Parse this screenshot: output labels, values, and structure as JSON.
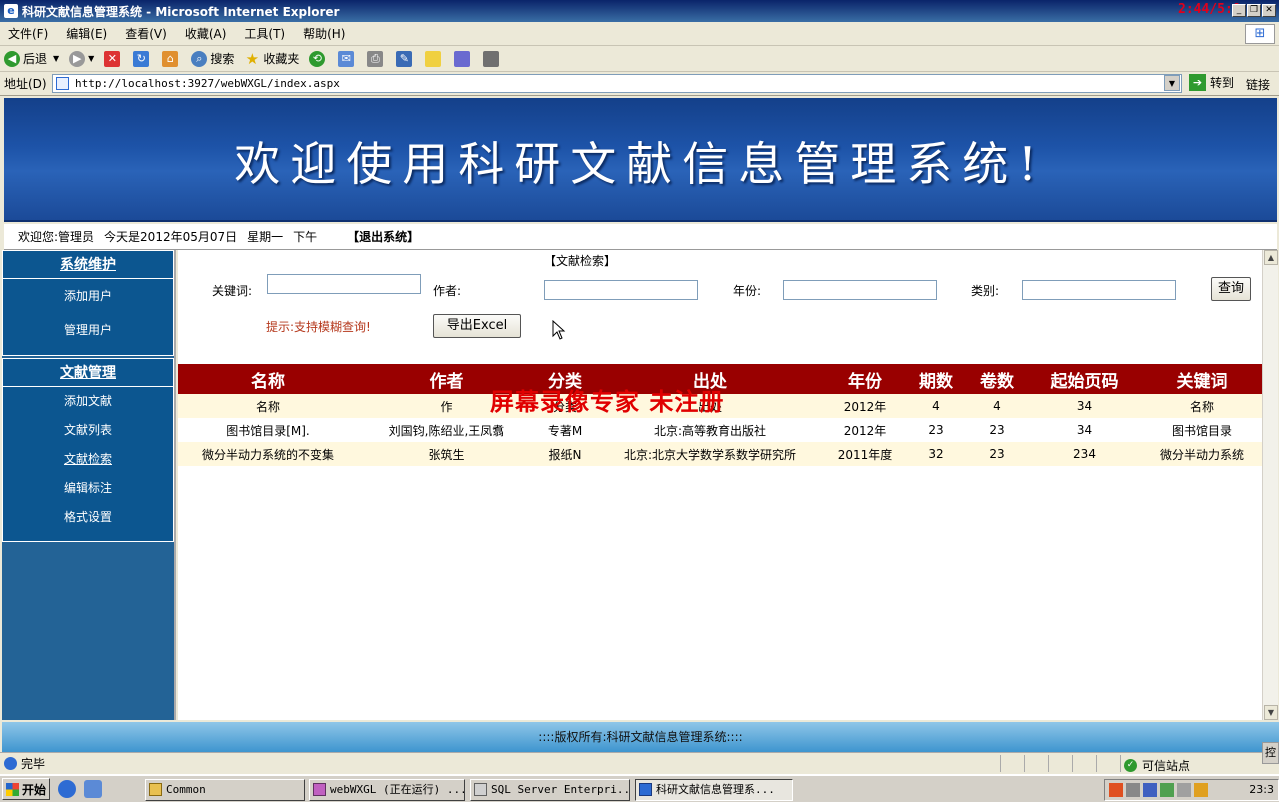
{
  "window": {
    "title": "科研文献信息管理系统 - Microsoft Internet Explorer",
    "clock": "2:44/5:8"
  },
  "menu": [
    "文件(F)",
    "编辑(E)",
    "查看(V)",
    "收藏(A)",
    "工具(T)",
    "帮助(H)"
  ],
  "toolbar": {
    "back": "后退",
    "search": "搜索",
    "favorites": "收藏夹"
  },
  "address": {
    "label": "地址(D)",
    "url": "http://localhost:3927/webWXGL/index.aspx",
    "go": "转到",
    "links": "链接"
  },
  "banner": {
    "title": "欢迎使用科研文献信息管理系统!"
  },
  "info": {
    "welcome": "欢迎您:管理员",
    "date": "今天是2012年05月07日",
    "weekday": "星期一",
    "period": "下午",
    "logout": "【退出系统】"
  },
  "sidebar": {
    "sections": [
      {
        "title": "系统维护",
        "items": [
          "添加用户",
          "管理用户"
        ]
      },
      {
        "title": "文献管理",
        "items": [
          "添加文献",
          "文献列表",
          "文献检索",
          "编辑标注",
          "格式设置"
        ]
      }
    ]
  },
  "search": {
    "heading": "【文献检索】",
    "keyword_label": "关键词:",
    "author_label": "作者:",
    "year_label": "年份:",
    "category_label": "类别:",
    "keyword_value": "",
    "author_value": "",
    "year_value": "",
    "category_value": "",
    "query_button": "查询",
    "hint": "提示:支持模糊查询!",
    "export_button": "导出Excel"
  },
  "table": {
    "headers": [
      "名称",
      "作者",
      "分类",
      "出处",
      "年份",
      "期数",
      "卷数",
      "起始页码",
      "关键词"
    ],
    "rows": [
      [
        "名称",
        "作",
        "分类",
        "出处",
        "2012年",
        "4",
        "4",
        "34",
        "名称"
      ],
      [
        "图书馆目录[M].",
        "刘国钧,陈绍业,王凤翥",
        "专著M",
        "北京:高等教育出版社",
        "2012年",
        "23",
        "23",
        "34",
        "图书馆目录"
      ],
      [
        "微分半动力系统的不变集",
        "张筑生",
        "报纸N",
        "北京:北京大学数学系数学研究所",
        "2011年度",
        "32",
        "23",
        "234",
        "微分半动力系统"
      ]
    ]
  },
  "watermark": "屏幕录像专家 未注册",
  "footer": "::::版权所有:科研文献信息管理系统::::",
  "status": {
    "text": "完毕",
    "zone": "可信站点",
    "ctrl": "控"
  },
  "taskbar": {
    "start": "开始",
    "tasks": [
      "Common",
      "webWXGL (正在运行) ...",
      "SQL Server Enterpri...",
      "科研文献信息管理系..."
    ],
    "time": "23:3"
  }
}
